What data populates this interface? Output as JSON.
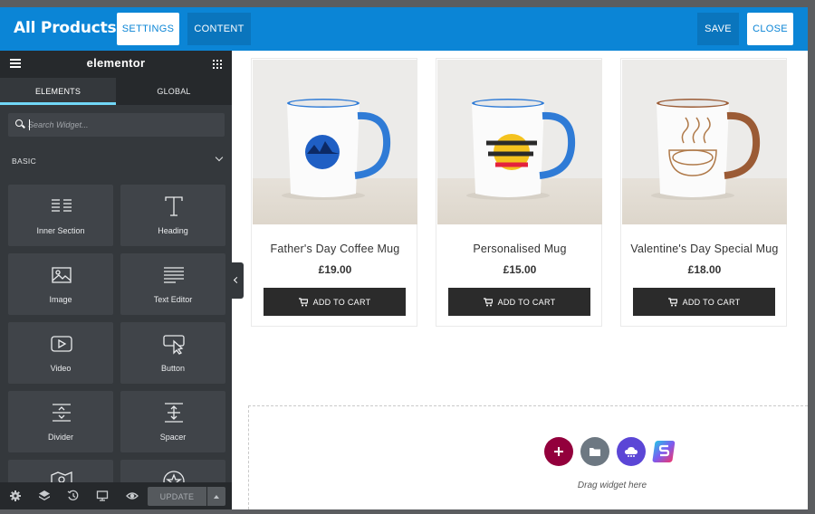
{
  "topbar": {
    "title": "All Products",
    "settings_label": "SETTINGS",
    "content_label": "CONTENT",
    "save_label": "SAVE",
    "close_label": "CLOSE",
    "accent": "#0b85d6"
  },
  "panel": {
    "logo": "elementor",
    "tabs": [
      "ELEMENTS",
      "GLOBAL"
    ],
    "search_placeholder": "Search Widget...",
    "section": "BASIC",
    "widgets": [
      {
        "label": "Inner Section",
        "icon": "columns-icon"
      },
      {
        "label": "Heading",
        "icon": "heading-t-icon"
      },
      {
        "label": "Image",
        "icon": "image-icon"
      },
      {
        "label": "Text Editor",
        "icon": "text-lines-icon"
      },
      {
        "label": "Video",
        "icon": "video-play-icon"
      },
      {
        "label": "Button",
        "icon": "button-cursor-icon"
      },
      {
        "label": "Divider",
        "icon": "divider-icon"
      },
      {
        "label": "Spacer",
        "icon": "spacer-icon"
      },
      {
        "label": "",
        "icon": "map-icon"
      },
      {
        "label": "",
        "icon": "star-icon"
      }
    ],
    "footer": {
      "update_label": "UPDATE",
      "icons": [
        "settings-gear-icon",
        "layers-icon",
        "history-icon",
        "responsive-icon",
        "preview-eye-icon"
      ]
    },
    "bg": "#34383c"
  },
  "products": [
    {
      "name": "Father's Day Coffee Mug",
      "price": "£19.00",
      "cta": "ADD TO CART",
      "mug_color": "#2f7bd6"
    },
    {
      "name": "Personalised Mug",
      "price": "£15.00",
      "cta": "ADD TO CART",
      "mug_color": "#2f7bd6"
    },
    {
      "name": "Valentine's Day Special Mug",
      "price": "£18.00",
      "cta": "ADD TO CART",
      "mug_color": "#9b5b35"
    }
  ],
  "dropzone": {
    "text": "Drag widget here",
    "buttons": [
      {
        "icon": "add-plus-icon",
        "color": "#93003c"
      },
      {
        "icon": "folder-icon",
        "color": "#6d7882"
      },
      {
        "icon": "cloud-kit-icon",
        "color": "#5b46d6"
      },
      {
        "icon": "s-logo-icon",
        "color": "#fff"
      }
    ]
  }
}
